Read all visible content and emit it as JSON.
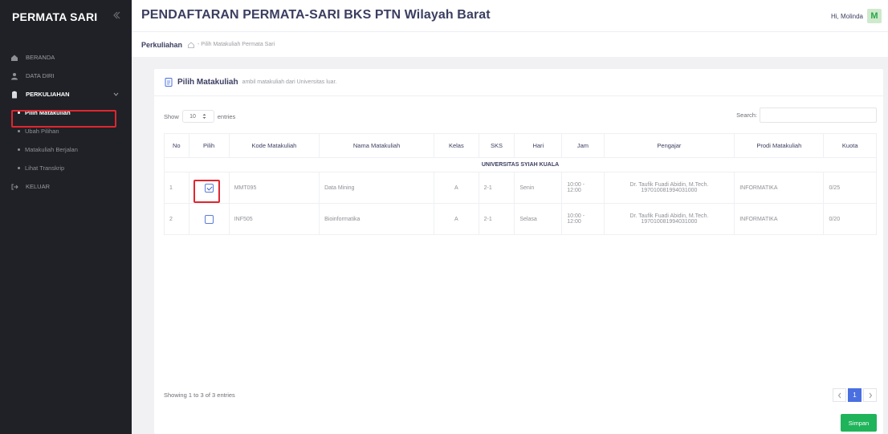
{
  "sidebar": {
    "brand": "PERMATA SARI",
    "items": [
      {
        "label": "BERANDA",
        "icon": "home-icon"
      },
      {
        "label": "DATA DIRI",
        "icon": "user-icon"
      },
      {
        "label": "PERKULIAHAN",
        "icon": "clipboard-icon",
        "expanded": true
      },
      {
        "label": "KELUAR",
        "icon": "logout-icon"
      }
    ],
    "submenu": [
      {
        "label": "Pilih Matakuliah",
        "active": true
      },
      {
        "label": "Ubah Pilihan"
      },
      {
        "label": "Matakuliah Berjalan"
      },
      {
        "label": "Lihat Transkrip"
      }
    ]
  },
  "header": {
    "title": "PENDAFTARAN PERMATA-SARI BKS PTN Wilayah Barat",
    "greeting": "Hi, Molinda",
    "avatar_letter": "M"
  },
  "breadcrumb": {
    "main": "Perkuliahan",
    "sub": "- Pilih Matakuliah Permata Sari"
  },
  "card": {
    "title": "Pilih Matakuliah",
    "subtitle": "ambil matakuliah dari Universitas luar."
  },
  "controls": {
    "show_label": "Show",
    "entries_value": "10",
    "entries_label": "entries",
    "search_label": "Search:",
    "search_value": ""
  },
  "table": {
    "columns": [
      "No",
      "Pilih",
      "Kode Matakuliah",
      "Nama Matakuliah",
      "Kelas",
      "SKS",
      "Hari",
      "Jam",
      "Pengajar",
      "Prodi Matakuliah",
      "Kuota"
    ],
    "group": "UNIVERSITAS SYIAH KUALA",
    "rows": [
      {
        "no": "1",
        "checked": true,
        "kode": "MMT095",
        "nama": "Data Mining",
        "kelas": "A",
        "sks": "2-1",
        "hari": "Senin",
        "jam": "10:00 - 12:00",
        "pengajar": "Dr. Taufik Fuadi Abidin, M.Tech.",
        "nip": "197010081994031000",
        "prodi": "INFORMATIKA",
        "kuota": "0/25"
      },
      {
        "no": "2",
        "checked": false,
        "kode": "INF505",
        "nama": "Bioinformatika",
        "kelas": "A",
        "sks": "2-1",
        "hari": "Selasa",
        "jam": "10:00 - 12:00",
        "pengajar": "Dr. Taufik Fuadi Abidin, M.Tech.",
        "nip": "197010081994031000",
        "prodi": "INFORMATIKA",
        "kuota": "0/20"
      }
    ]
  },
  "footer": {
    "info": "Showing 1 to 3 of 3 entries",
    "pages": [
      "1"
    ],
    "save_label": "Simpan"
  },
  "colors": {
    "sidebar_bg": "#1f2126",
    "accent": "#4a6fe0",
    "save_btn": "#1fb45a",
    "highlight": "#e0262f"
  }
}
